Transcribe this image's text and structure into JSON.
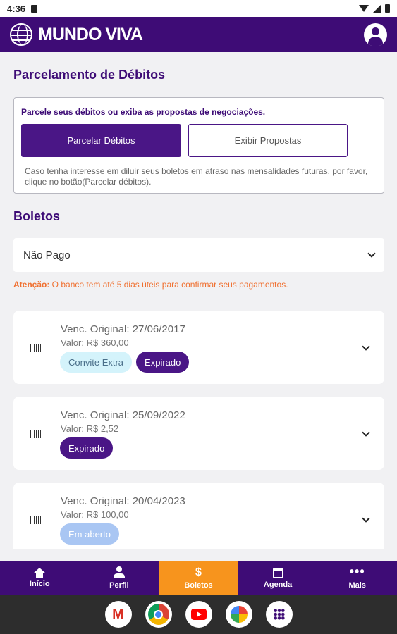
{
  "status_bar": {
    "time": "4:36"
  },
  "header": {
    "brand": "MUNDO VIVA"
  },
  "debts": {
    "title": "Parcelamento de Débitos",
    "intro": "Parcele seus débitos ou exiba as propostas de negociações.",
    "primary_button": "Parcelar Débitos",
    "secondary_button": "Exibir Propostas",
    "note": "Caso tenha interesse em diluir seus boletos em atraso nas mensalidades futuras, por favor, clique no botão(Parcelar débitos)."
  },
  "boletos": {
    "title": "Boletos",
    "filter_value": "Não Pago",
    "warning_label": "Atenção:",
    "warning_text": " O banco tem até 5 dias úteis para confirmar seus pagamentos.",
    "items": [
      {
        "venc": "Venc. Original: 27/06/2017",
        "valor": "Valor: R$ 360,00",
        "badges": [
          "Convite Extra",
          "Expirado"
        ]
      },
      {
        "venc": "Venc. Original: 25/09/2022",
        "valor": "Valor: R$ 2,52",
        "badges": [
          "Expirado"
        ]
      },
      {
        "venc": "Venc. Original: 20/04/2023",
        "valor": "Valor: R$ 100,00",
        "badges": [
          "Em aberto"
        ]
      }
    ]
  },
  "bottom_nav": {
    "items": [
      {
        "label": "Início",
        "icon": "home-icon"
      },
      {
        "label": "Perfil",
        "icon": "user-icon"
      },
      {
        "label": "Boletos",
        "icon": "dollar-icon",
        "active": true
      },
      {
        "label": "Agenda",
        "icon": "calendar-icon"
      },
      {
        "label": "Mais",
        "icon": "more-icon"
      }
    ]
  },
  "colors": {
    "brand": "#3e0c76",
    "accent": "#f7941d",
    "warning": "#f07030"
  }
}
